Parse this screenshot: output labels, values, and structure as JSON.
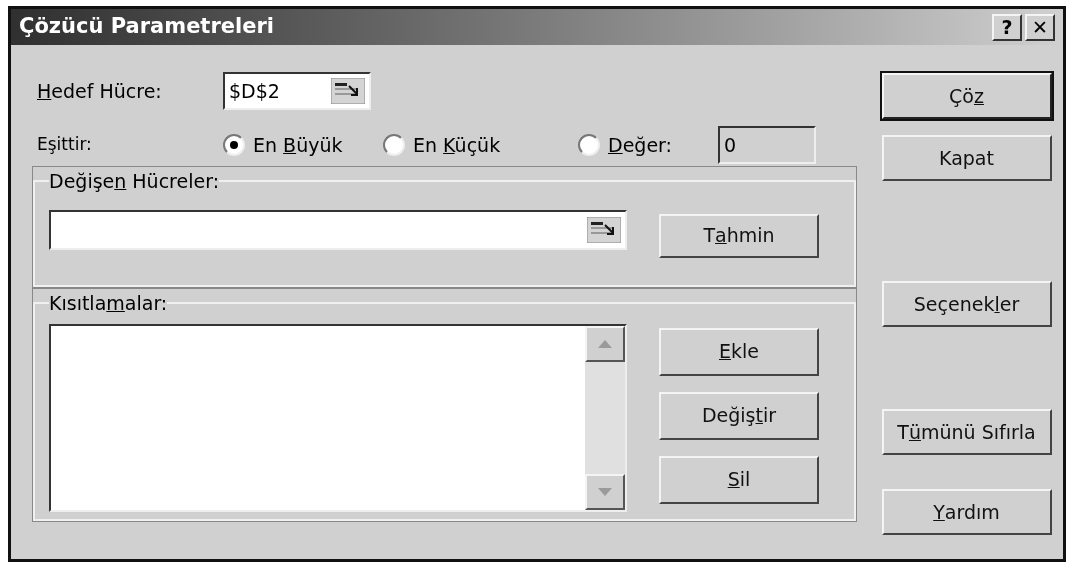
{
  "window": {
    "title": "Çözücü Parametreleri",
    "title_buttons": [
      "?",
      "✕"
    ]
  },
  "target_cell": {
    "label": {
      "key": "H",
      "post": "edef Hücre:"
    },
    "value": "$D$2"
  },
  "equal_to": {
    "label": "Eşittir:",
    "options": [
      {
        "label": {
          "pre": "En ",
          "key": "B",
          "post": "üyük"
        },
        "selected": true
      },
      {
        "label": {
          "pre": "En ",
          "key": "K",
          "post": "üçük"
        },
        "selected": false
      },
      {
        "label": {
          "key": "D",
          "post": "eğer:"
        },
        "selected": false
      }
    ],
    "value": "0"
  },
  "changing_cells": {
    "label": {
      "pre": "Değişe",
      "key": "n",
      "post": " Hücreler:"
    },
    "button": {
      "pre": "T",
      "key": "a",
      "post": "hmin"
    }
  },
  "constraints": {
    "label": {
      "pre": "Kısıtla",
      "key": "m",
      "post": "alar:"
    },
    "buttons": [
      {
        "key": "E",
        "post": "kle"
      },
      {
        "pre": "Değiş",
        "key": "t",
        "post": "ir"
      },
      {
        "key": "S",
        "post": "il"
      }
    ]
  },
  "side_buttons": [
    {
      "label": {
        "pre": "Çö",
        "key": "z"
      },
      "default": true
    },
    {
      "label": {
        "pre": "Kapat"
      },
      "default": false
    },
    {
      "label": {
        "pre": "Seçenek",
        "key": "l",
        "post": "er"
      },
      "default": false
    },
    {
      "label": {
        "pre": "T",
        "key": "ü",
        "post": "münü Sıfırla"
      },
      "default": false
    },
    {
      "label": {
        "key": "Y",
        "post": "ardım"
      },
      "default": false
    }
  ]
}
